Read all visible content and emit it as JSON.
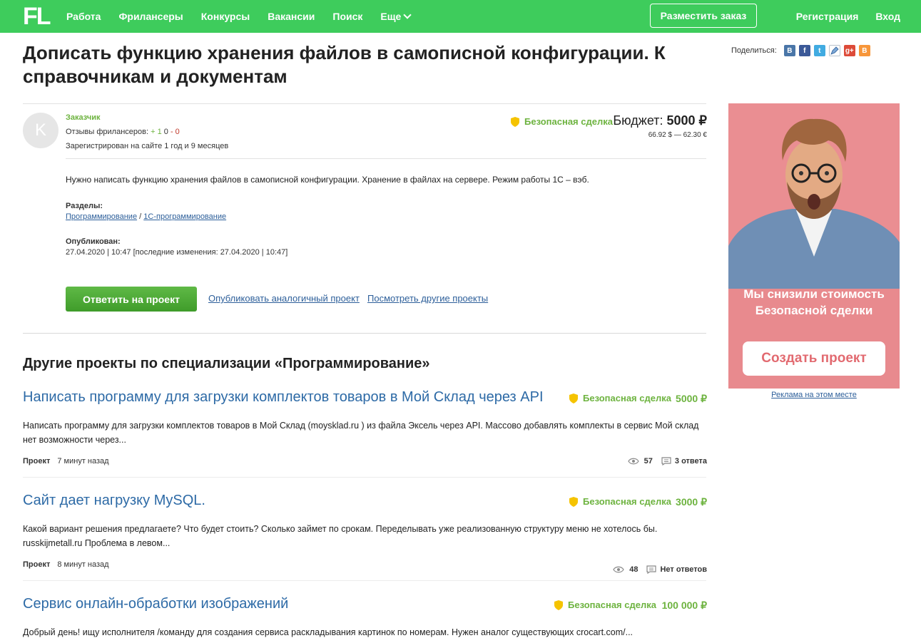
{
  "header": {
    "logo": "FL",
    "nav": [
      "Работа",
      "Фрилансеры",
      "Конкурсы",
      "Вакансии",
      "Поиск",
      "Еще"
    ],
    "place_order": "Разместить заказ",
    "register": "Регистрация",
    "login": "Вход"
  },
  "project": {
    "title": "Дописать функцию хранения файлов в самописной конфигурации. К справочникам и документам",
    "customer": {
      "avatar_letter": "K",
      "label": "Заказчик",
      "reviews_label": "Отзывы фрилансеров: ",
      "reviews_pos": "+ 1",
      "reviews_neutral": "0",
      "reviews_neg": "- 0",
      "registered": "Зарегистрирован на сайте 1 год и 9 месяцев"
    },
    "safe_deal": "Безопасная сделка",
    "budget_label": "Бюджет:",
    "budget_value": "5000 ₽",
    "budget_conversion": "66.92 $ — 62.30 €",
    "description": "Нужно написать функцию хранения файлов в самописной конфигурации. Хранение в файлах на сервере. Режим работы 1С – вэб.",
    "sections_label": "Разделы:",
    "section_1": "Программирование",
    "section_sep": "/",
    "section_2": "1С-программирование",
    "published_label": "Опубликован:",
    "published_date": "27.04.2020 | 10:47 [последние изменения: 27.04.2020 | 10:47]",
    "reply_button": "Ответить на проект",
    "publish_similar": "Опубликовать аналогичный проект",
    "view_other": "Посмотреть другие проекты"
  },
  "share": {
    "label": "Поделиться:",
    "icons": [
      "vk-icon",
      "facebook-icon",
      "twitter-icon",
      "livejournal-icon",
      "google-plus-icon",
      "blogger-icon"
    ]
  },
  "other": {
    "title": "Другие проекты по специализации «Программирование»",
    "projects": [
      {
        "title": "Написать программу для загрузки комплектов товаров в Мой Склад через API",
        "safe_deal": "Безопасная сделка",
        "price": "5000 ₽",
        "description": "Написать программу для загрузки комплектов товаров в Мой Склад (moysklad.ru ) из файла Эксель через API. Массово добавлять комплекты в сервис Мой склад нет возможности через...",
        "type": "Проект",
        "time": "7 минут назад",
        "views": "57",
        "answers": "3 ответа"
      },
      {
        "title": "Сайт дает нагрузку MySQL.",
        "safe_deal": "Безопасная сделка",
        "price": "3000 ₽",
        "description": "Какой вариант решения предлагаете? Что будет стоить? Сколько займет по срокам. Переделывать уже реализованную структуру меню не хотелось бы. russkijmetall.ru Проблема в левом...",
        "type": "Проект",
        "time": "8 минут назад",
        "views": "48",
        "answers": "Нет ответов"
      },
      {
        "title": "Сервис онлайн-обработки изображений",
        "safe_deal": "Безопасная сделка",
        "price": "100 000 ₽",
        "description": "Добрый день! ищу исполнителя /команду для создания сервиса раскладывания картинок по номерам. Нужен аналог существующих crocart.com/..."
      }
    ]
  },
  "ad": {
    "text_line1": "Мы снизили стоимость",
    "text_line2": "Безопасной сделки",
    "button": "Создать проект",
    "footer": "Реклама на этом месте"
  },
  "colors": {
    "brand_green": "#3ecc5c",
    "link_blue": "#2d5f9a",
    "price_green": "#6db33f",
    "ad_pink": "#e88a8e"
  }
}
